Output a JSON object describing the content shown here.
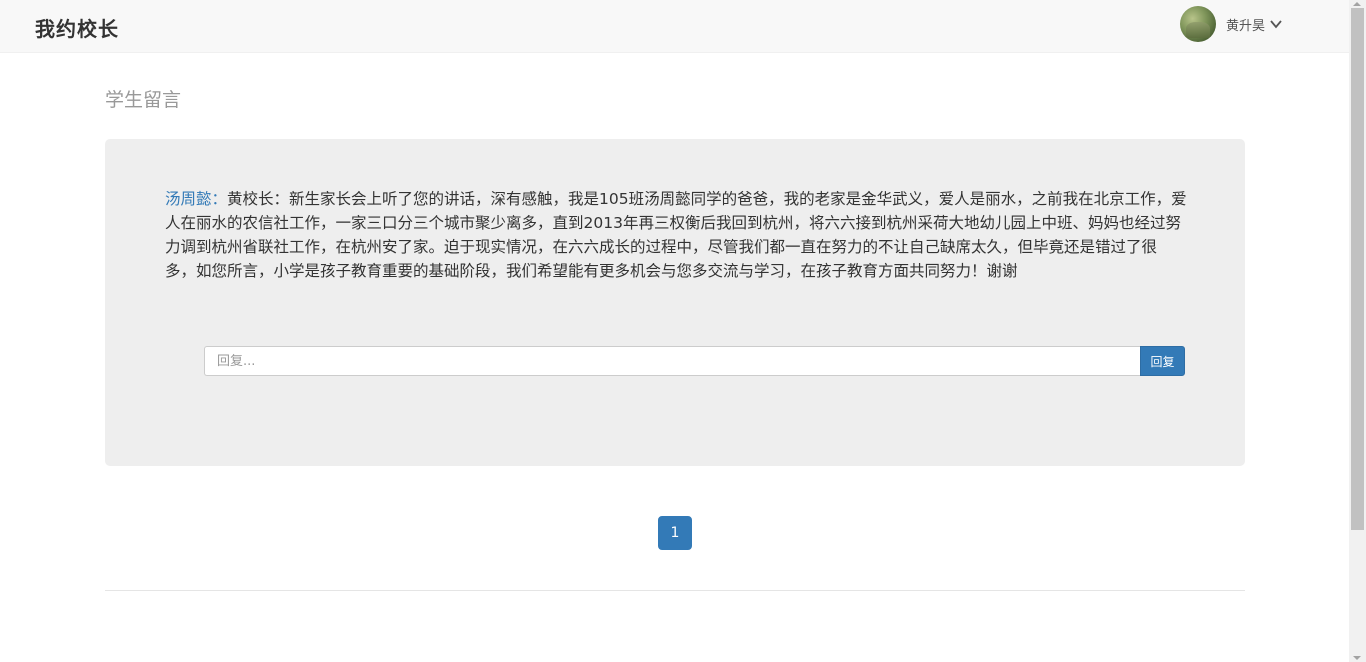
{
  "navbar": {
    "brand": "我约校长",
    "user_name": "黄升昊",
    "avatar_icon": "user-avatar",
    "dropdown_icon": "chevron-down-icon"
  },
  "main": {
    "section_title": "学生留言",
    "messages": [
      {
        "author": "汤周懿：",
        "text": "黄校长：新生家长会上听了您的讲话，深有感触，我是105班汤周懿同学的爸爸，我的老家是金华武义，爱人是丽水，之前我在北京工作，爱人在丽水的农信社工作，一家三口分三个城市聚少离多，直到2013年再三权衡后我回到杭州，将六六接到杭州采荷大地幼儿园上中班、妈妈也经过努力调到杭州省联社工作，在杭州安了家。迫于现实情况，在六六成长的过程中，尽管我们都一直在努力的不让自己缺席太久，但毕竟还是错过了很多，如您所言，小学是孩子教育重要的基础阶段，我们希望能有更多机会与您多交流与学习，在孩子教育方面共同努力！谢谢",
        "reply_placeholder": "回复...",
        "reply_button": "回复"
      }
    ]
  },
  "pagination": {
    "current_page": "1"
  },
  "colors": {
    "primary": "#337ab7",
    "panel_bg": "#eeeeee",
    "navbar_bg": "#f8f8f8"
  }
}
